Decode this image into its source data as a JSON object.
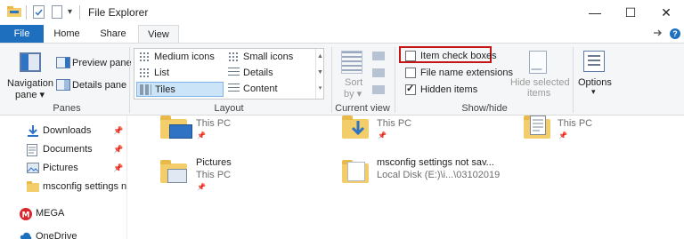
{
  "window": {
    "title": "File Explorer"
  },
  "title_bar": {
    "minimize": "—",
    "maximize": "☐",
    "close": "✕",
    "qa_dropdown": "▾"
  },
  "tabs": [
    "File",
    "Home",
    "Share",
    "View"
  ],
  "active_tab": "View",
  "ribbon": {
    "panes": {
      "label": "Panes",
      "navigation_pane_line1": "Navigation",
      "navigation_pane_line2": "pane ▾",
      "preview_pane": "Preview pane",
      "details_pane": "Details pane"
    },
    "layout": {
      "label": "Layout",
      "options": [
        "Medium icons",
        "Small icons",
        "List",
        "Details",
        "Tiles",
        "Content"
      ],
      "selected": "Tiles"
    },
    "current_view": {
      "label": "Current view",
      "sort_line1": "Sort",
      "sort_line2": "by ▾"
    },
    "show_hide": {
      "label": "Show/hide",
      "item_check_boxes": {
        "label": "Item check boxes",
        "checked": false
      },
      "file_name_extensions": {
        "label": "File name extensions",
        "checked": false
      },
      "hidden_items": {
        "label": "Hidden items",
        "checked": true
      },
      "hide_selected_line1": "Hide selected",
      "hide_selected_line2": "items"
    },
    "options": {
      "label": "Options",
      "arrow": "▾"
    }
  },
  "nav_pane": {
    "items": [
      {
        "label": "Downloads",
        "icon": "download-arrow-icon",
        "pinned": true
      },
      {
        "label": "Documents",
        "icon": "document-icon",
        "pinned": true
      },
      {
        "label": "Pictures",
        "icon": "pictures-icon",
        "pinned": true
      },
      {
        "label": "msconfig settings n",
        "icon": "folder-icon",
        "pinned": false
      },
      {
        "label": "MEGA",
        "icon": "mega-icon",
        "pinned": false
      },
      {
        "label": "OneDrive",
        "icon": "onedrive-icon",
        "pinned": false
      }
    ]
  },
  "tiles": [
    {
      "name": "",
      "sub": "This PC",
      "pinned": true,
      "icon": "desktop-folder-icon"
    },
    {
      "name": "",
      "sub": "This PC",
      "pinned": true,
      "icon": "downloads-folder-icon"
    },
    {
      "name": "",
      "sub": "This PC",
      "pinned": true,
      "icon": "documents-folder-icon"
    },
    {
      "name": "Pictures",
      "sub": "This PC",
      "pinned": true,
      "icon": "pictures-folder-icon"
    },
    {
      "name": "msconfig settings not sav...",
      "sub": "Local Disk (E:)\\i...\\03102019",
      "pinned": false,
      "icon": "folder-icon"
    }
  ],
  "colors": {
    "accent": "#1f6fbf",
    "highlight_box": "#c51616",
    "folder": "#f3cd6a",
    "selection": "#cce4f7"
  }
}
